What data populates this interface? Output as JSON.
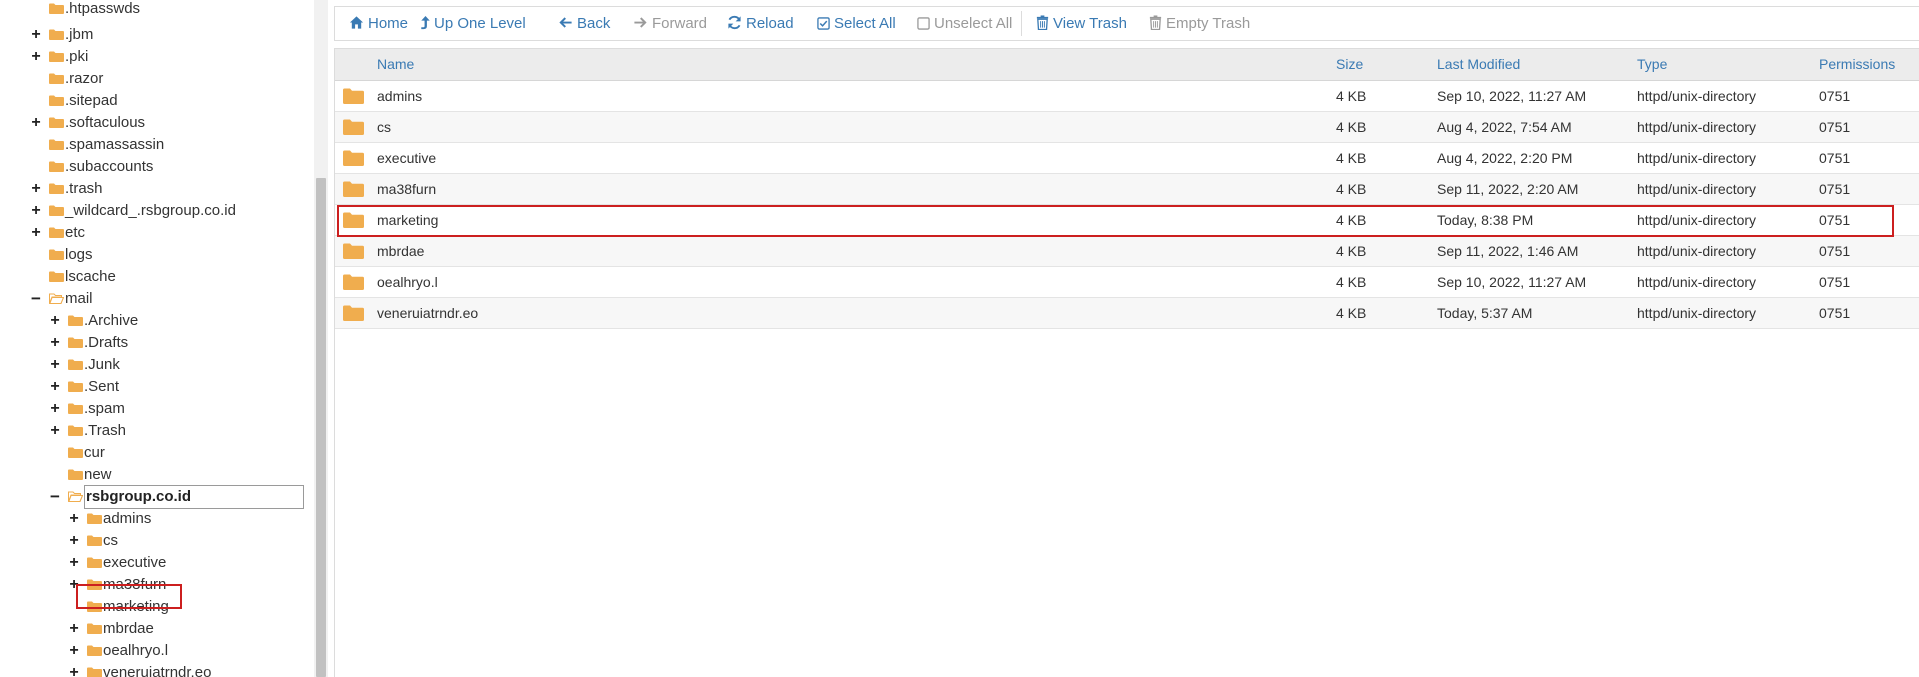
{
  "colors": {
    "link": "#3a7ab3",
    "folder": "#f0ad4e",
    "highlight": "#cc1f1f",
    "header_bg": "#ececec"
  },
  "tree": {
    "items": [
      {
        "label": ".htpasswds",
        "toggle": "",
        "depth": 0,
        "icon": "folder-icon"
      },
      {
        "label": ".jbm",
        "toggle": "+",
        "depth": 0,
        "icon": "folder-icon"
      },
      {
        "label": ".pki",
        "toggle": "+",
        "depth": 0,
        "icon": "folder-icon"
      },
      {
        "label": ".razor",
        "toggle": "",
        "depth": 0,
        "icon": "folder-icon"
      },
      {
        "label": ".sitepad",
        "toggle": "",
        "depth": 0,
        "icon": "folder-icon"
      },
      {
        "label": ".softaculous",
        "toggle": "+",
        "depth": 0,
        "icon": "folder-icon"
      },
      {
        "label": ".spamassassin",
        "toggle": "",
        "depth": 0,
        "icon": "folder-icon"
      },
      {
        "label": ".subaccounts",
        "toggle": "",
        "depth": 0,
        "icon": "folder-icon"
      },
      {
        "label": ".trash",
        "toggle": "+",
        "depth": 0,
        "icon": "folder-icon"
      },
      {
        "label": "_wildcard_.rsbgroup.co.id",
        "toggle": "+",
        "depth": 0,
        "icon": "folder-icon"
      },
      {
        "label": "etc",
        "toggle": "+",
        "depth": 0,
        "icon": "folder-icon"
      },
      {
        "label": "logs",
        "toggle": "",
        "depth": 0,
        "icon": "folder-icon"
      },
      {
        "label": "lscache",
        "toggle": "",
        "depth": 0,
        "icon": "folder-icon"
      },
      {
        "label": "mail",
        "toggle": "−",
        "depth": 0,
        "icon": "folder-open-icon"
      },
      {
        "label": ".Archive",
        "toggle": "+",
        "depth": 1,
        "icon": "folder-icon"
      },
      {
        "label": ".Drafts",
        "toggle": "+",
        "depth": 1,
        "icon": "folder-icon"
      },
      {
        "label": ".Junk",
        "toggle": "+",
        "depth": 1,
        "icon": "folder-icon"
      },
      {
        "label": ".Sent",
        "toggle": "+",
        "depth": 1,
        "icon": "folder-icon"
      },
      {
        "label": ".spam",
        "toggle": "+",
        "depth": 1,
        "icon": "folder-icon"
      },
      {
        "label": ".Trash",
        "toggle": "+",
        "depth": 1,
        "icon": "folder-icon"
      },
      {
        "label": "cur",
        "toggle": "",
        "depth": 1,
        "icon": "folder-icon"
      },
      {
        "label": "new",
        "toggle": "",
        "depth": 1,
        "icon": "folder-icon"
      },
      {
        "label": "rsbgroup.co.id",
        "toggle": "−",
        "depth": 1,
        "icon": "folder-open-icon",
        "current": true
      },
      {
        "label": "admins",
        "toggle": "+",
        "depth": 2,
        "icon": "folder-icon"
      },
      {
        "label": "cs",
        "toggle": "+",
        "depth": 2,
        "icon": "folder-icon"
      },
      {
        "label": "executive",
        "toggle": "+",
        "depth": 2,
        "icon": "folder-icon"
      },
      {
        "label": "ma38furn",
        "toggle": "+",
        "depth": 2,
        "icon": "folder-icon"
      },
      {
        "label": "marketing",
        "toggle": "",
        "depth": 2,
        "icon": "folder-icon",
        "highlighted": true
      },
      {
        "label": "mbrdae",
        "toggle": "+",
        "depth": 2,
        "icon": "folder-icon"
      },
      {
        "label": "oealhryo.l",
        "toggle": "+",
        "depth": 2,
        "icon": "folder-icon"
      },
      {
        "label": "veneruiatrndr.eo",
        "toggle": "+",
        "depth": 2,
        "icon": "folder-icon"
      }
    ]
  },
  "toolbar": {
    "home": "Home",
    "up_one_level": "Up One Level",
    "back": "Back",
    "forward": "Forward",
    "reload": "Reload",
    "select_all": "Select All",
    "unselect_all": "Unselect All",
    "view_trash": "View Trash",
    "empty_trash": "Empty Trash"
  },
  "table": {
    "columns": {
      "name": "Name",
      "size": "Size",
      "last_modified": "Last Modified",
      "type": "Type",
      "permissions": "Permissions"
    },
    "rows": [
      {
        "name": "admins",
        "size": "4 KB",
        "modified": "Sep 10, 2022, 11:27 AM",
        "type": "httpd/unix-directory",
        "perms": "0751"
      },
      {
        "name": "cs",
        "size": "4 KB",
        "modified": "Aug 4, 2022, 7:54 AM",
        "type": "httpd/unix-directory",
        "perms": "0751"
      },
      {
        "name": "executive",
        "size": "4 KB",
        "modified": "Aug 4, 2022, 2:20 PM",
        "type": "httpd/unix-directory",
        "perms": "0751"
      },
      {
        "name": "ma38furn",
        "size": "4 KB",
        "modified": "Sep 11, 2022, 2:20 AM",
        "type": "httpd/unix-directory",
        "perms": "0751"
      },
      {
        "name": "marketing",
        "size": "4 KB",
        "modified": "Today, 8:38 PM",
        "type": "httpd/unix-directory",
        "perms": "0751",
        "highlighted": true
      },
      {
        "name": "mbrdae",
        "size": "4 KB",
        "modified": "Sep 11, 2022, 1:46 AM",
        "type": "httpd/unix-directory",
        "perms": "0751"
      },
      {
        "name": "oealhryo.l",
        "size": "4 KB",
        "modified": "Sep 10, 2022, 11:27 AM",
        "type": "httpd/unix-directory",
        "perms": "0751"
      },
      {
        "name": "veneruiatrndr.eo",
        "size": "4 KB",
        "modified": "Today, 5:37 AM",
        "type": "httpd/unix-directory",
        "perms": "0751"
      }
    ]
  }
}
